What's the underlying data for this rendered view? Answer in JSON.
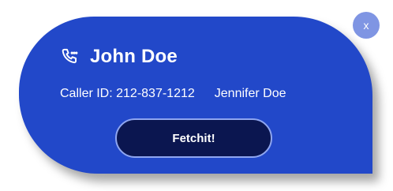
{
  "popup": {
    "caller_name": "John Doe",
    "caller_id_text": "Caller ID: 212-837-1212",
    "contact_name": "Jennifer Doe",
    "action_label": "Fetchit!",
    "close_label": "x",
    "phone_icon": "phone-ringing-icon"
  },
  "colors": {
    "card": "#2248c9",
    "button": "#0b1650",
    "close": "#7f95e3",
    "text": "#ffffff"
  }
}
